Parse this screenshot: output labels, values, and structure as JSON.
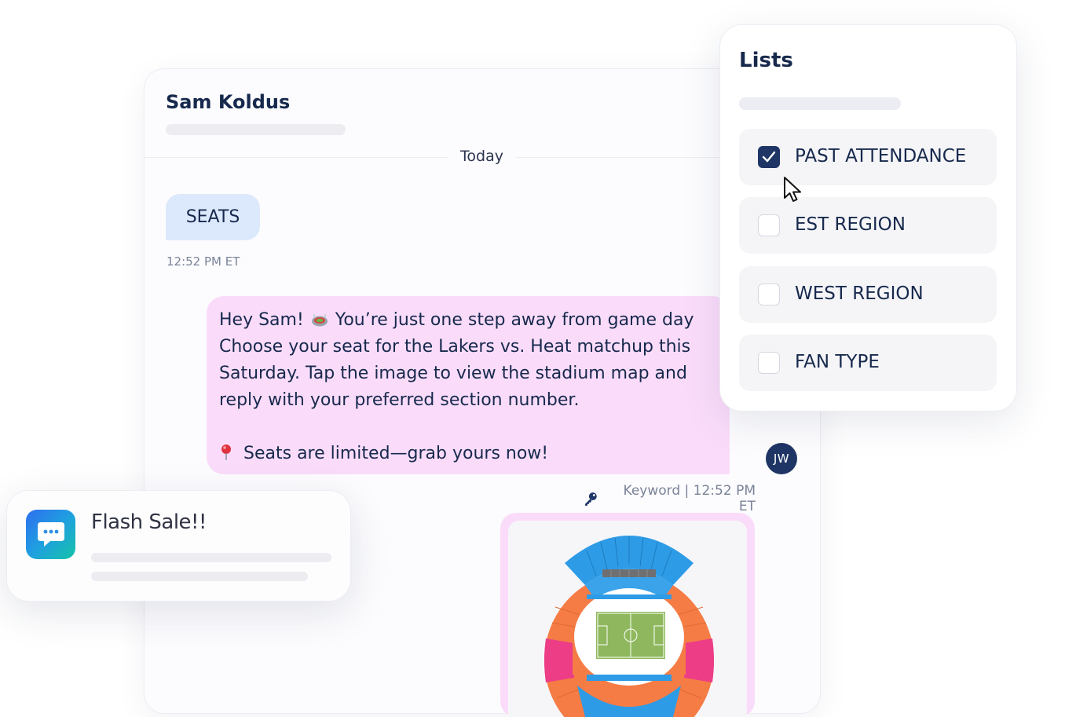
{
  "chat": {
    "contact_name": "Sam Koldus",
    "date_label": "Today",
    "incoming": {
      "text": "SEATS",
      "time": "12:52 PM ET"
    },
    "outgoing": {
      "line1_pre": "Hey Sam!",
      "line1_post": "You’re just one step away from game day",
      "line2": "Choose your seat for the Lakers vs. Heat matchup this",
      "line3": "Saturday. Tap the image to view the stadium map and",
      "line4": "reply with your preferred section number.",
      "line5": "Seats are limited—grab yours now!",
      "meta": "Keyword | 12:52 PM ET"
    },
    "agent_initials": "JW"
  },
  "lists": {
    "title": "Lists",
    "items": [
      {
        "label": "PAST ATTENDANCE",
        "checked": true
      },
      {
        "label": "EST REGION",
        "checked": false
      },
      {
        "label": "WEST REGION",
        "checked": false
      },
      {
        "label": "FAN TYPE",
        "checked": false
      }
    ]
  },
  "notification": {
    "title": "Flash Sale!!"
  },
  "colors": {
    "primary": "#1e3565",
    "incoming_bubble": "#dce9fc",
    "outgoing_bubble": "#fadcfa",
    "stadium_blue": "#2e9be6",
    "stadium_orange": "#f57c45",
    "stadium_pink": "#ec3d86",
    "pitch_green": "#8fb85e"
  }
}
